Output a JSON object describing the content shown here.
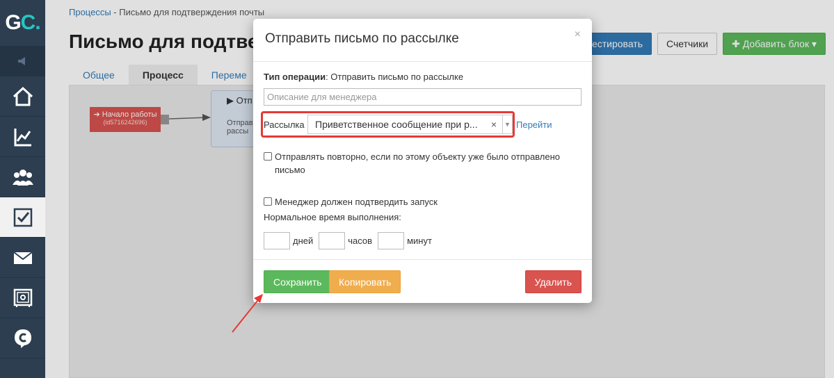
{
  "brand": {
    "logo_g": "G",
    "logo_c": "C",
    "logo_dot": "."
  },
  "sidebar": {
    "items": [
      {
        "icon": "home-icon"
      },
      {
        "icon": "chart-icon"
      },
      {
        "icon": "users-icon"
      },
      {
        "icon": "tasks-icon",
        "active": true
      },
      {
        "icon": "mail-icon"
      },
      {
        "icon": "safe-icon"
      },
      {
        "icon": "chat-icon"
      }
    ]
  },
  "breadcrumb": {
    "parent": "Процессы",
    "separator": " - ",
    "current": "Письмо для подтверждения почты"
  },
  "page": {
    "title": "Письмо для подтве",
    "buttons": {
      "test": "Тестировать",
      "counters": "Счетчики",
      "add_block": "Добавить блок"
    },
    "tabs": [
      {
        "label": "Общее"
      },
      {
        "label": "Процесс",
        "active": true
      },
      {
        "label": "Переме"
      }
    ]
  },
  "canvas": {
    "start_node": {
      "label": "Начало работы",
      "sub": "(id5716242696)"
    },
    "process_node": {
      "title": "Отп",
      "line1": "Отправ",
      "line2": "рассы"
    }
  },
  "modal": {
    "title": "Отправить письмо по рассылке",
    "close": "×",
    "op_type_label": "Тип операции",
    "op_type_value": ": Отправить письмо по рассылке",
    "description_placeholder": "Описание для менеджера",
    "mailing_label": "Рассылка",
    "mailing_value": "Приветственное сообщение при р...",
    "mailing_clear": "×",
    "mailing_arrow": "▼",
    "goto_link": "Перейти",
    "resend_label": "Отправлять повторно, если по этому объекту уже было отправлено письмо",
    "manager_confirm_label": "Менеджер должен подтвердить запуск",
    "normal_time_label": "Нормальное время выполнения:",
    "time_units": {
      "days": "дней",
      "hours": "часов",
      "minutes": "минут"
    },
    "buttons": {
      "save": "Сохранить",
      "copy": "Копировать",
      "delete": "Удалить"
    }
  },
  "colors": {
    "accent_red": "#e53935",
    "sidebar_bg": "#2c3e50",
    "logo_accent": "#27c5c3"
  }
}
